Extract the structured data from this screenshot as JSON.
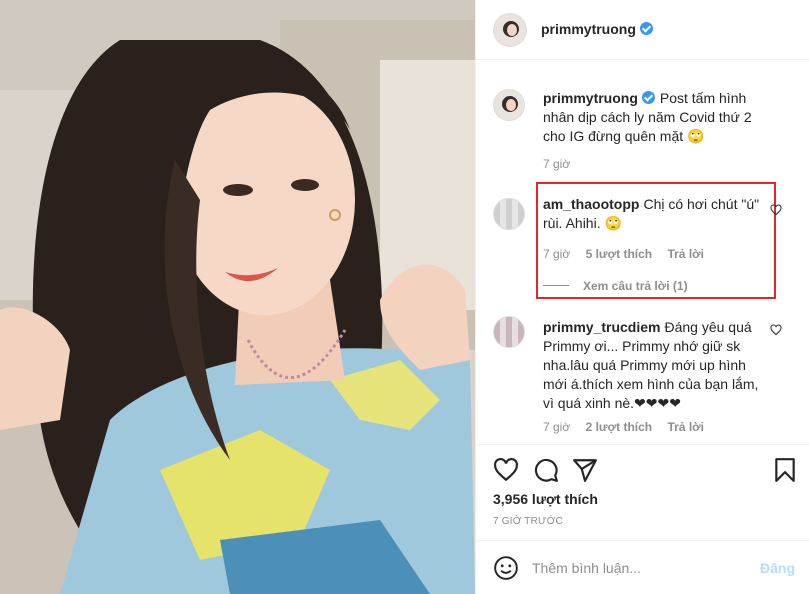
{
  "header": {
    "username": "primmytruong"
  },
  "caption": {
    "username": "primmytruong",
    "text": "Post tấm hình nhân dịp cách ly năm Covid thứ 2 cho IG đừng quên mặt 🙄",
    "time": "7 giờ"
  },
  "comments": [
    {
      "username": "am_thaootopp",
      "text": "Chị có hơi chút \"ú\" rùi. Ahihi. 🙄",
      "time": "7 giờ",
      "likes": "5 lượt thích",
      "reply": "Trả lời",
      "view_replies": "Xem câu trả lời (1)"
    },
    {
      "username": "primmy_trucdiem",
      "text": "Đáng yêu quá Primmy ơi... Primmy nhớ giữ sk nha.lâu quá Primmy mới up hình mới á.thích xem hình của bạn lắm, vì quá xinh nè.❤❤❤❤",
      "time": "7 giờ",
      "likes": "2 lượt thích",
      "reply": "Trả lời"
    }
  ],
  "actions": {
    "like_count": "3,956 lượt thích",
    "time_ago": "7 GIỜ TRƯỚC"
  },
  "add_comment": {
    "placeholder": "Thêm bình luận...",
    "post_label": "Đăng"
  },
  "colors": {
    "accent": "#3897f0",
    "highlight": "#e2262b",
    "muted": "#8e8e8e",
    "post_disabled": "#b2dffc"
  },
  "icons": [
    "verified-badge-icon",
    "heart-icon",
    "comment-icon",
    "share-icon",
    "bookmark-icon",
    "emoji-icon"
  ]
}
